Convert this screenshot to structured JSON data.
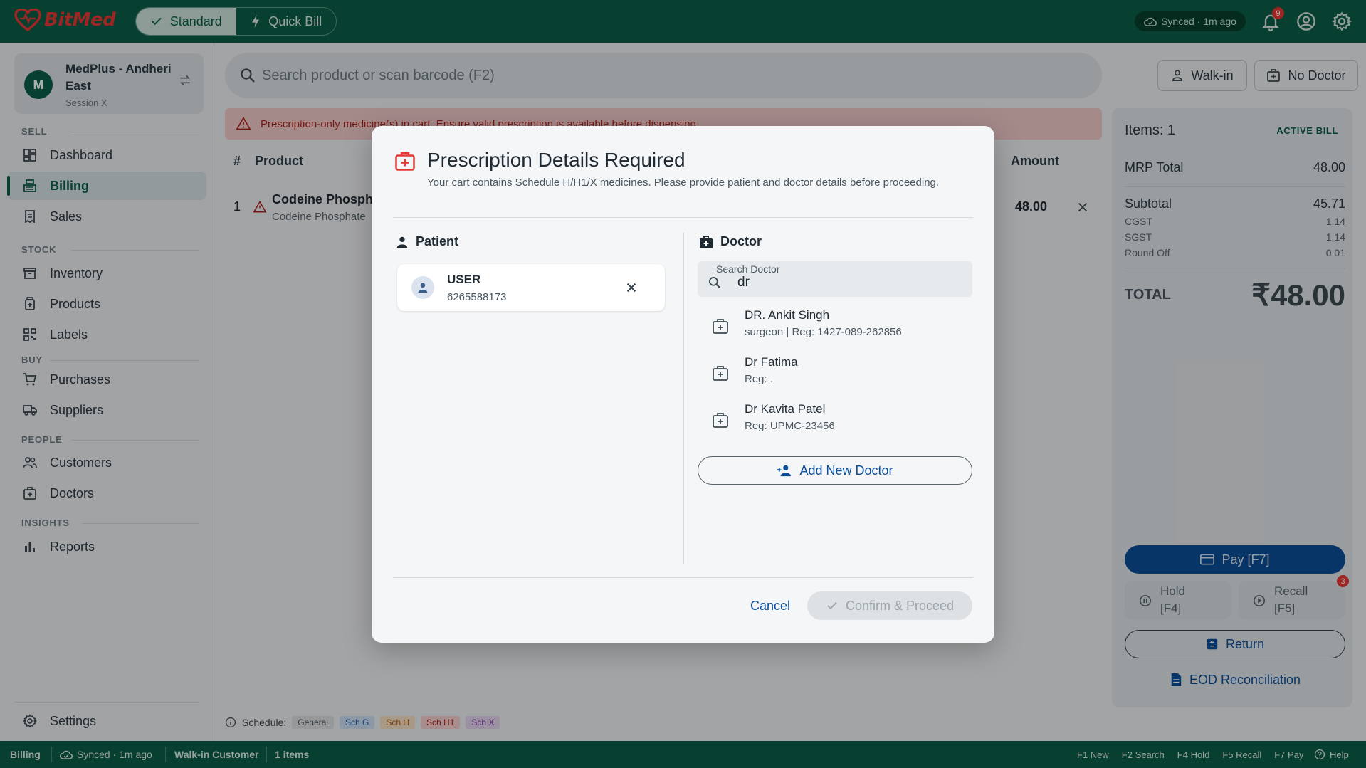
{
  "app": {
    "brand": "BitMed"
  },
  "topbar": {
    "mode_standard": "Standard",
    "mode_quick": "Quick Bill",
    "synced": "Synced · 1m ago",
    "notifications_count": "9"
  },
  "store": {
    "name": "MedPlus - Andheri East",
    "session": "Session X",
    "initial": "M"
  },
  "sidebar": {
    "sections": {
      "sell": "SELL",
      "stock": "STOCK",
      "buy": "BUY",
      "people": "PEOPLE",
      "insights": "INSIGHTS"
    },
    "items": {
      "dashboard": "Dashboard",
      "billing": "Billing",
      "sales": "Sales",
      "inventory": "Inventory",
      "products": "Products",
      "labels": "Labels",
      "purchases": "Purchases",
      "suppliers": "Suppliers",
      "customers": "Customers",
      "doctors": "Doctors",
      "reports": "Reports",
      "settings": "Settings"
    }
  },
  "main": {
    "search_placeholder": "Search product or scan barcode (F2)",
    "walkin": "Walk-in",
    "no_doctor": "No Doctor",
    "warning": "Prescription-only medicine(s) in cart. Ensure valid prescription is available before dispensing.",
    "table": {
      "headers": {
        "index": "#",
        "product": "Product",
        "amount": "Amount"
      },
      "rows": [
        {
          "index": "1",
          "name": "Codeine Phospha",
          "sub": "Codeine Phosphate",
          "amount": "48.00"
        }
      ]
    },
    "schedule_legend": {
      "label": "Schedule:",
      "tags": [
        "General",
        "Sch G",
        "Sch H",
        "Sch H1",
        "Sch X"
      ]
    }
  },
  "bill": {
    "items": "Items: 1",
    "status": "ACTIVE BILL",
    "mrp_total_label": "MRP Total",
    "mrp_total": "48.00",
    "subtotal_label": "Subtotal",
    "subtotal": "45.71",
    "cgst_label": "CGST",
    "cgst": "1.14",
    "sgst_label": "SGST",
    "sgst": "1.14",
    "roundoff_label": "Round Off",
    "roundoff": "0.01",
    "total_label": "TOTAL",
    "total": "₹48.00",
    "pay": "Pay  [F7]",
    "hold": "Hold\n[F4]",
    "hold_line1": "Hold",
    "hold_line2": "[F4]",
    "recall_line1": "Recall",
    "recall_line2": "[F5]",
    "recall_count": "3",
    "return": "Return",
    "eod": "EOD Reconciliation"
  },
  "statusbar": {
    "screen": "Billing",
    "synced": "Synced · 1m ago",
    "customer": "Walk-in Customer",
    "items": "1 items",
    "shortcuts": [
      "F1 New",
      "F2 Search",
      "F4 Hold",
      "F5 Recall",
      "F7 Pay"
    ],
    "help": "Help"
  },
  "modal": {
    "title": "Prescription Details Required",
    "subtitle": "Your cart contains Schedule H/H1/X medicines. Please provide patient and doctor details before proceeding.",
    "patient_heading": "Patient",
    "patient": {
      "name": "USER",
      "phone": "6265588173"
    },
    "doctor_heading": "Doctor",
    "doctor_search_label": "Search Doctor",
    "doctor_search_value": "dr",
    "doctors": [
      {
        "name": "DR. Ankit Singh",
        "meta": "surgeon | Reg: 1427-089-262856"
      },
      {
        "name": "Dr Fatima",
        "meta": "Reg: ."
      },
      {
        "name": "Dr Kavita Patel",
        "meta": "Reg: UPMC-23456"
      }
    ],
    "add_doctor": "Add New Doctor",
    "cancel": "Cancel",
    "confirm": "Confirm & Proceed"
  },
  "colors": {
    "brand": "#0b5d48",
    "accent": "#0b4f9a",
    "danger": "#e53935"
  }
}
